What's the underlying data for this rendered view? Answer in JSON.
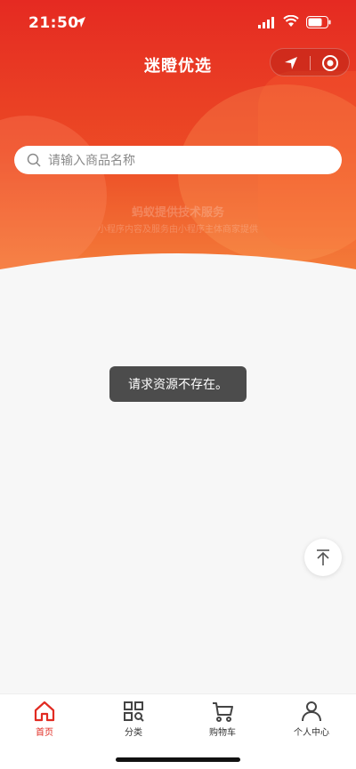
{
  "status": {
    "time": "21:50"
  },
  "nav": {
    "title": "迷瞪优选"
  },
  "search": {
    "placeholder": "请输入商品名称"
  },
  "watermark": {
    "line1": "蚂蚁提供技术服务",
    "line2": "小程序内容及服务由小程序主体商家提供"
  },
  "toast": {
    "message": "请求资源不存在。"
  },
  "tabbar": {
    "items": [
      {
        "label": "首页",
        "icon": "home-icon",
        "active": true
      },
      {
        "label": "分类",
        "icon": "category-icon",
        "active": false
      },
      {
        "label": "购物车",
        "icon": "cart-icon",
        "active": false
      },
      {
        "label": "个人中心",
        "icon": "user-icon",
        "active": false
      }
    ]
  },
  "colors": {
    "accent": "#e12b22",
    "header_top": "#e52a22",
    "header_bottom": "#f47e3a",
    "toast_bg": "#4c4c4c"
  }
}
